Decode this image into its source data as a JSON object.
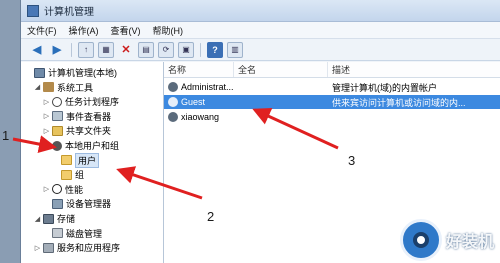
{
  "window": {
    "title": "计算机管理"
  },
  "menu": [
    "文件(F)",
    "操作(A)",
    "查看(V)",
    "帮助(H)"
  ],
  "tree": [
    {
      "label": "计算机管理(本地)",
      "twisty": "",
      "icon": "pc",
      "indent": 0
    },
    {
      "label": "系统工具",
      "twisty": "◢",
      "icon": "tools",
      "indent": 1
    },
    {
      "label": "任务计划程序",
      "twisty": "▷",
      "icon": "clock",
      "indent": 2
    },
    {
      "label": "事件查看器",
      "twisty": "▷",
      "icon": "event",
      "indent": 2
    },
    {
      "label": "共享文件夹",
      "twisty": "▷",
      "icon": "share",
      "indent": 2
    },
    {
      "label": "本地用户和组",
      "twisty": "◢",
      "icon": "users",
      "indent": 2
    },
    {
      "label": "用户",
      "twisty": "",
      "icon": "folder",
      "indent": 3,
      "selected": true
    },
    {
      "label": "组",
      "twisty": "",
      "icon": "folder",
      "indent": 3
    },
    {
      "label": "性能",
      "twisty": "▷",
      "icon": "perf",
      "indent": 2
    },
    {
      "label": "设备管理器",
      "twisty": "",
      "icon": "device",
      "indent": 2
    },
    {
      "label": "存储",
      "twisty": "◢",
      "icon": "storage",
      "indent": 1
    },
    {
      "label": "磁盘管理",
      "twisty": "",
      "icon": "disk",
      "indent": 2
    },
    {
      "label": "服务和应用程序",
      "twisty": "▷",
      "icon": "svc",
      "indent": 1
    }
  ],
  "columns": {
    "name": "名称",
    "full": "全名",
    "desc": "描述"
  },
  "rows": [
    {
      "name": "Administrat...",
      "full": "",
      "desc": "管理计算机(域)的内置帐户"
    },
    {
      "name": "Guest",
      "full": "",
      "desc": "供来宾访问计算机或访问域的内...",
      "selected": true
    },
    {
      "name": "xiaowang",
      "full": "",
      "desc": ""
    }
  ],
  "annotations": [
    "1",
    "2",
    "3"
  ],
  "arrow_color": "#e02020",
  "watermark": {
    "text": "好装机"
  }
}
